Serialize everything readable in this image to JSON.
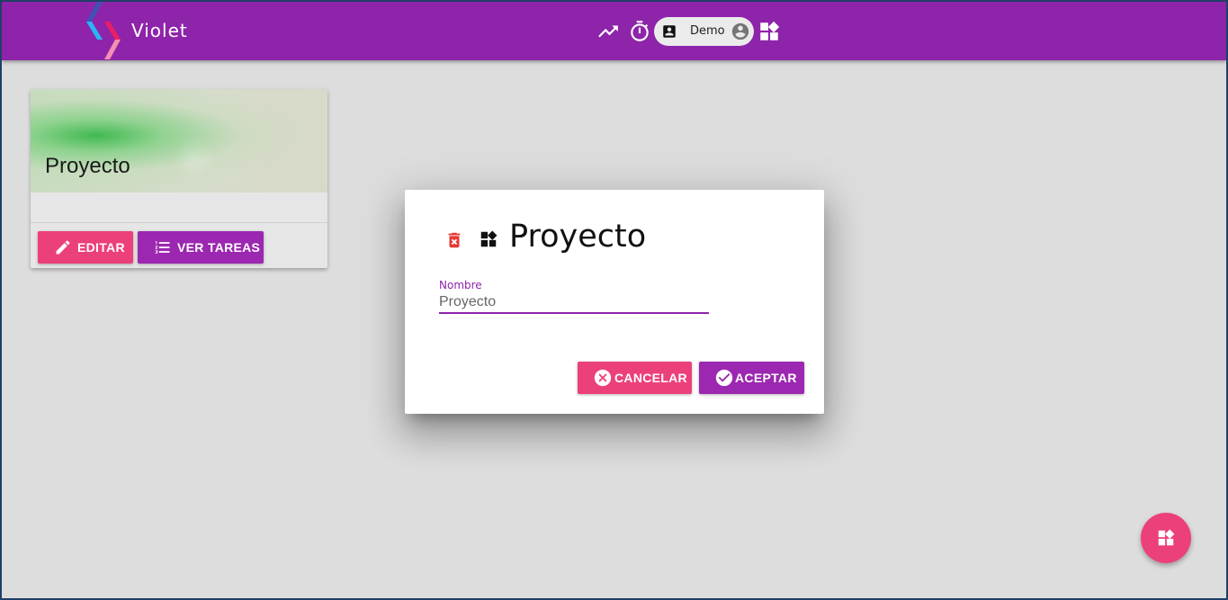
{
  "app": {
    "title": "Violet",
    "accent_color": "#8e24aa",
    "pink_color": "#ec407a",
    "purple_button_color": "#9c27b0"
  },
  "topbar": {
    "icons": [
      "trending-up-icon",
      "timer-icon",
      "widgets-icon"
    ],
    "user_chip": {
      "name": "Demo",
      "left_icon": "account-box-icon",
      "right_icon": "account-circle-icon"
    }
  },
  "card": {
    "title": "Proyecto",
    "edit_label": "EDITAR",
    "tasks_label": "VER TAREAS",
    "edit_icon": "pencil-icon",
    "tasks_icon": "list-numbered-icon"
  },
  "dialog": {
    "title": "Proyecto",
    "delete_icon": "delete-forever-icon",
    "title_icon": "widgets-icon",
    "field": {
      "label": "Nombre",
      "value": "Proyecto"
    },
    "cancel_label": "CANCELAR",
    "accept_label": "ACEPTAR",
    "cancel_icon": "close-circle-icon",
    "accept_icon": "check-circle-icon"
  },
  "fab": {
    "icon": "widgets-icon"
  }
}
